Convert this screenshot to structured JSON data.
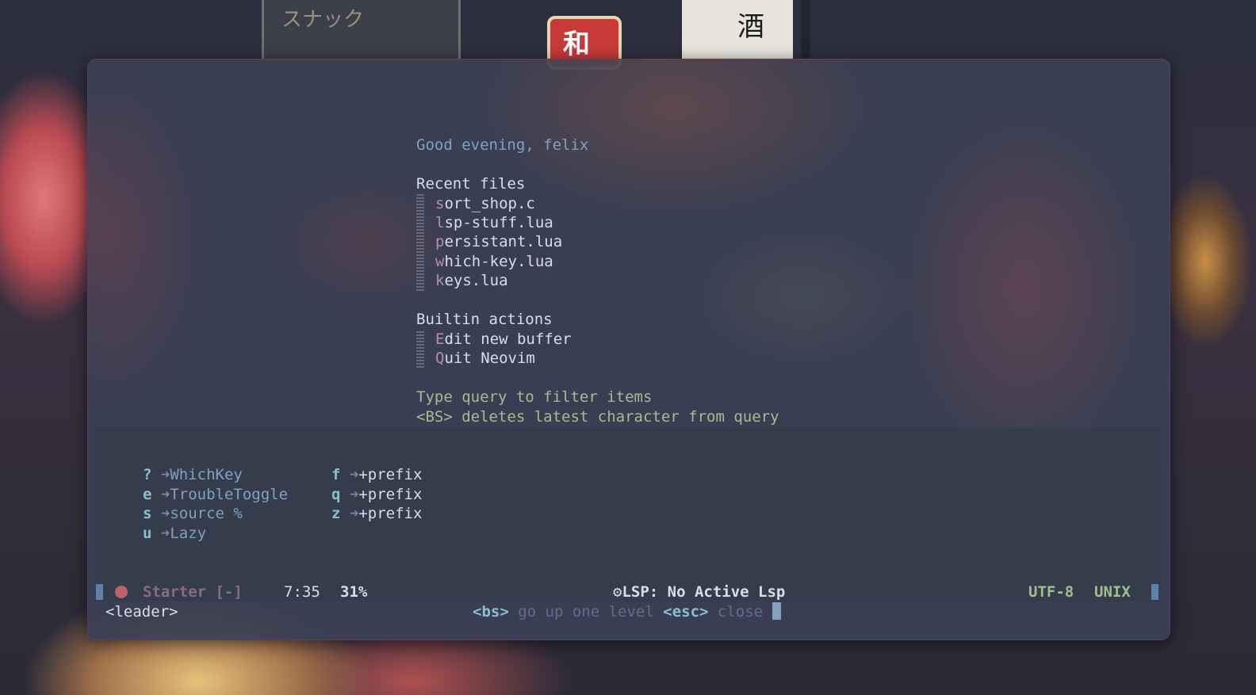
{
  "wallpaper": {
    "sign_left": "スナック",
    "sign_center": "和",
    "sign_right": "酒"
  },
  "starter": {
    "greeting": "Good evening, felix",
    "recent_header": "Recent files",
    "recent_files": [
      {
        "key": "s",
        "rest": "ort_shop.c"
      },
      {
        "key": "l",
        "rest": "sp-stuff.lua"
      },
      {
        "key": "p",
        "rest": "ersistant.lua"
      },
      {
        "key": "w",
        "rest": "hich-key.lua"
      },
      {
        "key": "k",
        "rest": "eys.lua"
      }
    ],
    "builtin_header": "Builtin actions",
    "builtin_actions": [
      {
        "key": "E",
        "rest": "dit new buffer"
      },
      {
        "key": "Q",
        "rest": "uit Neovim"
      }
    ],
    "hint_1": "Type query to filter items",
    "hint_2": "<BS> deletes latest character from query"
  },
  "whichkey": {
    "arrow": "➜",
    "col1": [
      {
        "key": "?",
        "desc": "WhichKey"
      },
      {
        "key": "e",
        "desc": "TroubleToggle"
      },
      {
        "key": "s",
        "desc": "source %"
      },
      {
        "key": "u",
        "desc": "Lazy"
      }
    ],
    "col2": [
      {
        "key": "f",
        "desc": "+prefix"
      },
      {
        "key": "q",
        "desc": "+prefix"
      },
      {
        "key": "z",
        "desc": "+prefix"
      }
    ]
  },
  "statusline": {
    "filename": "Starter [-]",
    "position": "7:35",
    "percent": "31%",
    "lsp_icon": "⚙",
    "lsp": "LSP: No Active Lsp",
    "encoding": "UTF-8",
    "fileformat": "UNIX",
    "colors": {
      "accent": "#5e81ac",
      "error": "#bf616a",
      "green": "#a3be8c"
    }
  },
  "cmdline": {
    "leader": "<leader>",
    "bs_key": "<bs>",
    "bs_desc": "go up one level",
    "esc_key": "<esc>",
    "esc_desc": "close"
  }
}
